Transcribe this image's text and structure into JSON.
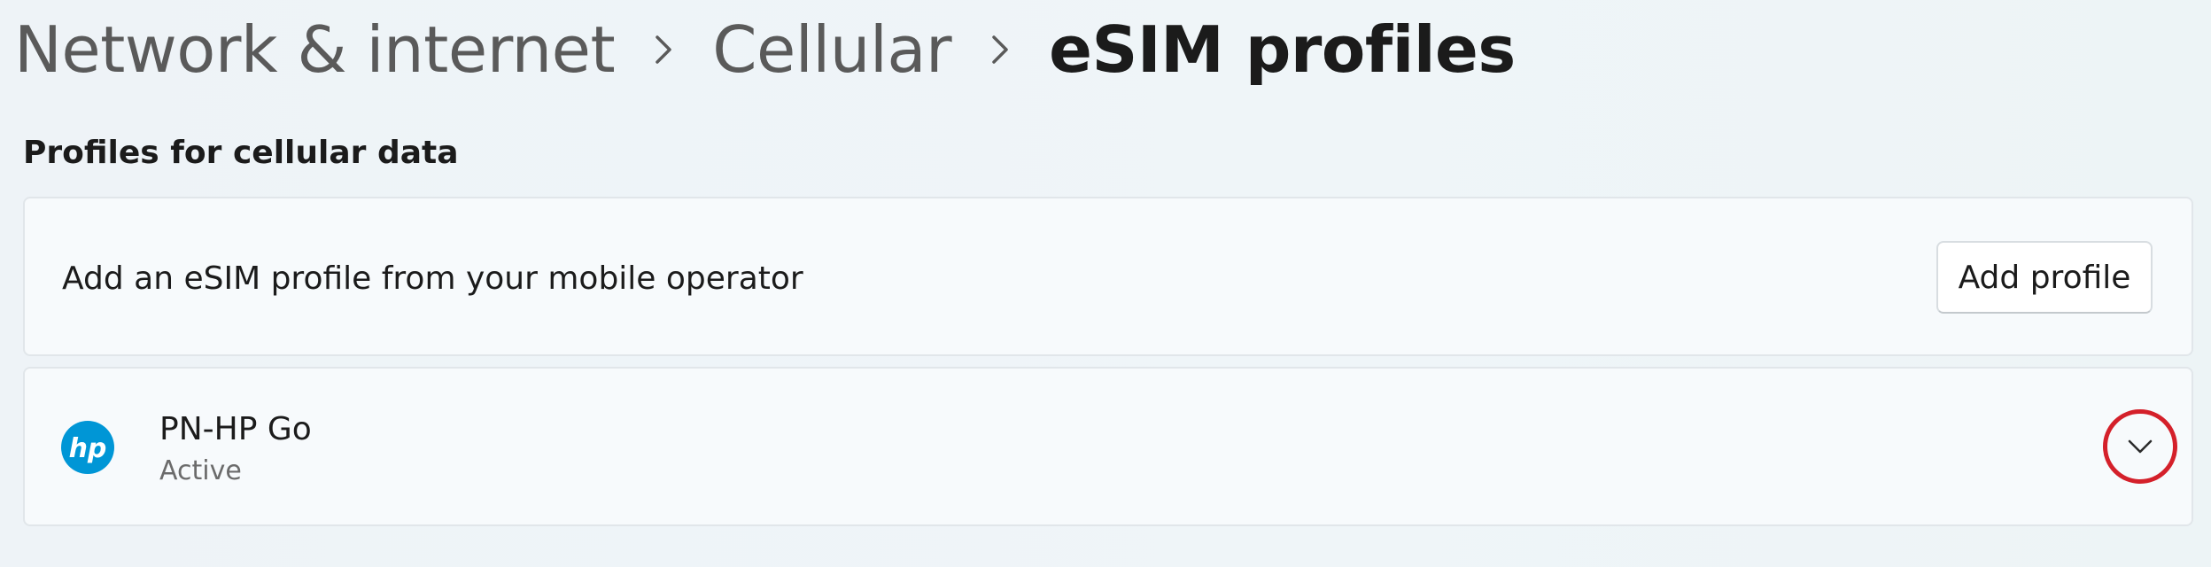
{
  "breadcrumb": {
    "items": [
      {
        "label": "Network & internet"
      },
      {
        "label": "Cellular"
      },
      {
        "label": "eSIM profiles"
      }
    ],
    "separator_icon": "chevron-right-icon"
  },
  "section": {
    "title": "Profiles for cellular data"
  },
  "add_card": {
    "label": "Add an eSIM profile from your mobile operator",
    "button_label": "Add profile"
  },
  "profile": {
    "icon": "hp-logo-icon",
    "name": "PN-HP Go",
    "status": "Active",
    "expand_icon": "chevron-down-icon"
  },
  "colors": {
    "hp_blue": "#0096d6",
    "highlight_ring": "#d4202a"
  }
}
